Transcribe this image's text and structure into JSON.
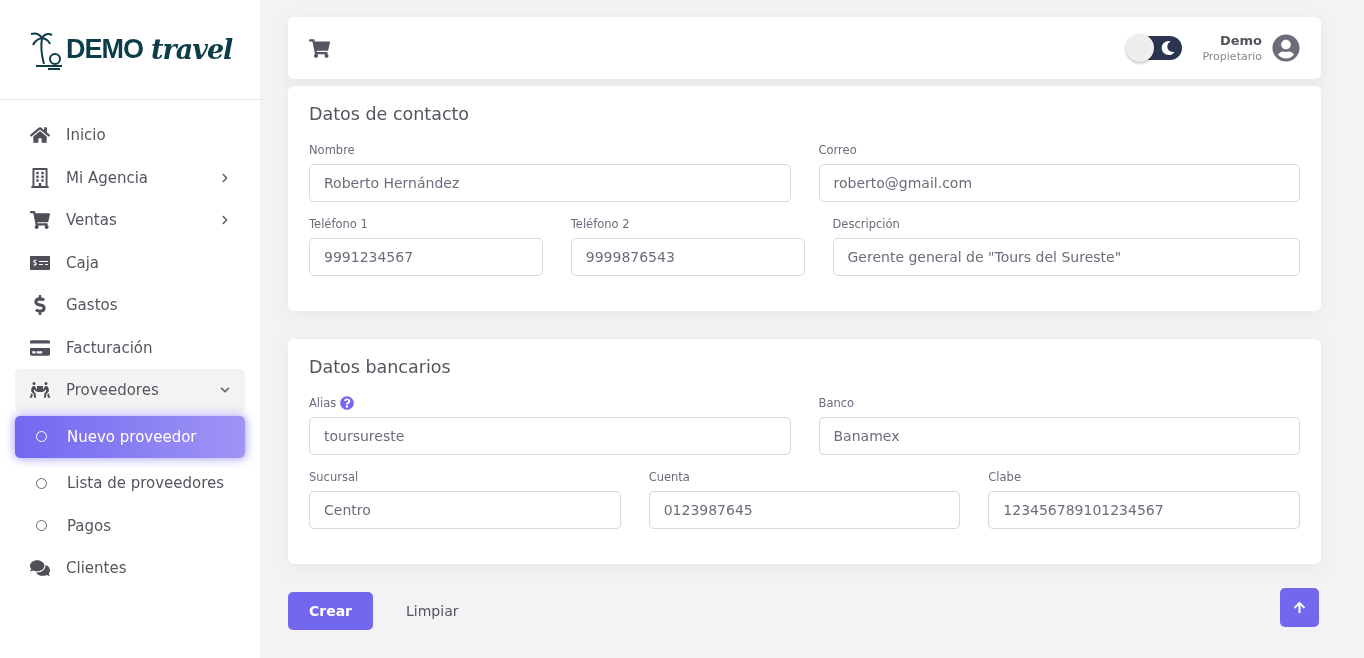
{
  "logo": {
    "brand": "DEMO",
    "script": "travel"
  },
  "sidebar": {
    "items": [
      {
        "kind": "item",
        "label": "Inicio",
        "expandable": false,
        "expanded": false,
        "selected": false
      },
      {
        "kind": "item",
        "label": "Mi Agencia",
        "expandable": true,
        "expanded": false,
        "selected": false
      },
      {
        "kind": "item",
        "label": "Ventas",
        "expandable": true,
        "expanded": false,
        "selected": false
      },
      {
        "kind": "item",
        "label": "Caja",
        "expandable": false,
        "expanded": false,
        "selected": false
      },
      {
        "kind": "item",
        "label": "Gastos",
        "expandable": false,
        "expanded": false,
        "selected": false
      },
      {
        "kind": "item",
        "label": "Facturación",
        "expandable": false,
        "expanded": false,
        "selected": false
      },
      {
        "kind": "item",
        "label": "Proveedores",
        "expandable": true,
        "expanded": true,
        "selected": false
      },
      {
        "kind": "subitem",
        "label": "Nuevo proveedor",
        "selected": true
      },
      {
        "kind": "subitem",
        "label": "Lista de proveedores",
        "selected": false
      },
      {
        "kind": "subitem",
        "label": "Pagos",
        "selected": false
      },
      {
        "kind": "item",
        "label": "Clientes",
        "expandable": false,
        "expanded": false,
        "selected": false
      }
    ]
  },
  "header": {
    "dark_mode": true,
    "user": {
      "name": "Demo",
      "role": "Propietario"
    }
  },
  "sections": [
    {
      "title": "Datos de contacto",
      "fields": [
        {
          "label": "Nombre",
          "value": "Roberto Hernández",
          "help": false
        },
        {
          "label": "Correo",
          "value": "roberto@gmail.com",
          "help": false
        },
        {
          "label": "Teléfono 1",
          "value": "9991234567",
          "help": false
        },
        {
          "label": "Teléfono 2",
          "value": "9999876543",
          "help": false
        },
        {
          "label": "Descripción",
          "value": "Gerente general de \"Tours del Sureste\"",
          "help": false
        }
      ]
    },
    {
      "title": "Datos bancarios",
      "fields": [
        {
          "label": "Alias",
          "value": "toursureste",
          "help": true
        },
        {
          "label": "Banco",
          "value": "Banamex",
          "help": false
        },
        {
          "label": "Sucursal",
          "value": "Centro",
          "help": false
        },
        {
          "label": "Cuenta",
          "value": "0123987645",
          "help": false
        },
        {
          "label": "Clabe",
          "value": "123456789101234567",
          "help": false
        }
      ]
    }
  ],
  "actions": [
    {
      "label": "Crear",
      "kind": "primary"
    },
    {
      "label": "Limpiar",
      "kind": "plain"
    }
  ]
}
